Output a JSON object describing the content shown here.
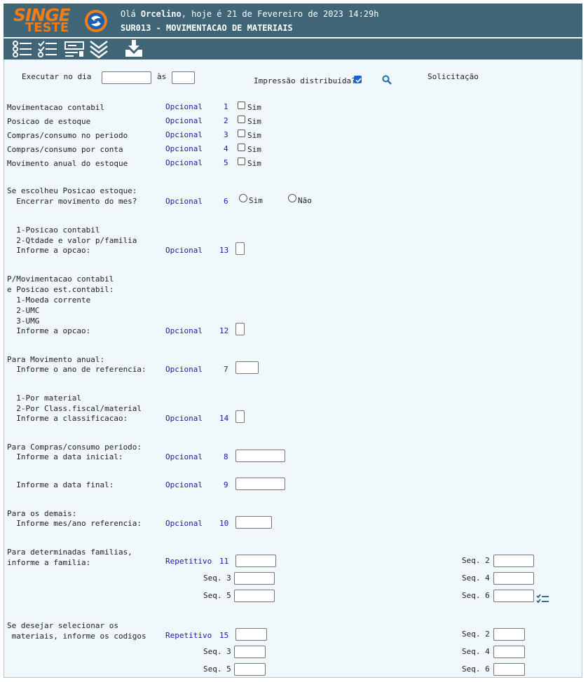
{
  "header": {
    "logo_top": "SINGE",
    "logo_bottom": "TESTE",
    "greeting_prefix": "Olá",
    "user": "Orcelino",
    "greeting_suffix": ", hoje é 21 de Fevereiro de 2023 14:29h",
    "title": "SUR013 - MOVIMENTACAO DE MATERIAIS"
  },
  "toolbar": {
    "icons": [
      "list-icon",
      "checklist-icon",
      "form-icon",
      "chevrons-down-icon",
      "download-icon"
    ]
  },
  "top": {
    "execute_label": "Executar no dia",
    "at_label": "às",
    "print_label": "Impressão distribuída?",
    "print_checked": true,
    "request_label": "Solicitação"
  },
  "options": [
    {
      "label": "Movimentacao contabil",
      "status": "Opcional",
      "num": "1",
      "check": "Sim"
    },
    {
      "label": "Posicao de estoque",
      "status": "Opcional",
      "num": "2",
      "check": "Sim"
    },
    {
      "label": "Compras/consumo no periodo",
      "status": "Opcional",
      "num": "3",
      "check": "Sim"
    },
    {
      "label": "Compras/consumo por conta",
      "status": "Opcional",
      "num": "4",
      "check": "Sim"
    },
    {
      "label": "Movimento anual do estoque",
      "status": "Opcional",
      "num": "5",
      "check": "Sim"
    }
  ],
  "sec6": {
    "line1": "Se escolheu Posicao estoque:",
    "line2": "  Encerrar movimento do mes?",
    "status": "Opcional",
    "num": "6",
    "yes": "Sim",
    "no": "Não"
  },
  "sec13": {
    "line1": "  1-Posicao contabil",
    "line2": "  2-Qtdade e valor p/familia",
    "line3": "  Informe a opcao:",
    "status": "Opcional",
    "num": "13"
  },
  "sec12": {
    "line1": "P/Movimentacao contabil",
    "line2": "e Posicao est.contabil:",
    "line3": "  1-Moeda corrente",
    "line4": "  2-UMC",
    "line5": "  3-UMG",
    "line6": "  Informe a opcao:",
    "status": "Opcional",
    "num": "12"
  },
  "sec7": {
    "line1": "Para Movimento anual:",
    "line2": "  Informe o ano de referencia:",
    "status": "Opcional",
    "num": "7"
  },
  "sec14": {
    "line1": "  1-Por material",
    "line2": "  2-Por Class.fiscal/material",
    "line3": "  Informe a classificacao:",
    "status": "Opcional",
    "num": "14"
  },
  "sec8": {
    "line1": "Para Compras/consumo periodo:",
    "line2": "  Informe a data inicial:",
    "status": "Opcional",
    "num": "8"
  },
  "sec9": {
    "line1": "  Informe a data final:",
    "status": "Opcional",
    "num": "9"
  },
  "sec10": {
    "line1": "Para os demais:",
    "line2": "  Informe mes/ano referencia:",
    "status": "Opcional",
    "num": "10"
  },
  "sec11": {
    "line1": "Para determinadas familias,",
    "line2": "informe a familia:",
    "status": "Repetitivo",
    "num": "11",
    "seq2": "Seq. 2",
    "seq3": "Seq. 3",
    "seq4": "Seq. 4",
    "seq5": "Seq. 5",
    "seq6": "Seq. 6"
  },
  "sec15": {
    "line1": "Se desejar selecionar os",
    "line2": " materiais, informe os codigos",
    "status": "Repetitivo",
    "num": "15",
    "seq2": "Seq. 2",
    "seq3": "Seq. 3",
    "seq4": "Seq. 4",
    "seq5": "Seq. 5",
    "seq6": "Seq. 6"
  },
  "colors": {
    "header_bg": "#3f6577",
    "logo": "#ef7d1a",
    "status_text": "#1a1aa8",
    "page_bg": "#f1f8fb"
  }
}
